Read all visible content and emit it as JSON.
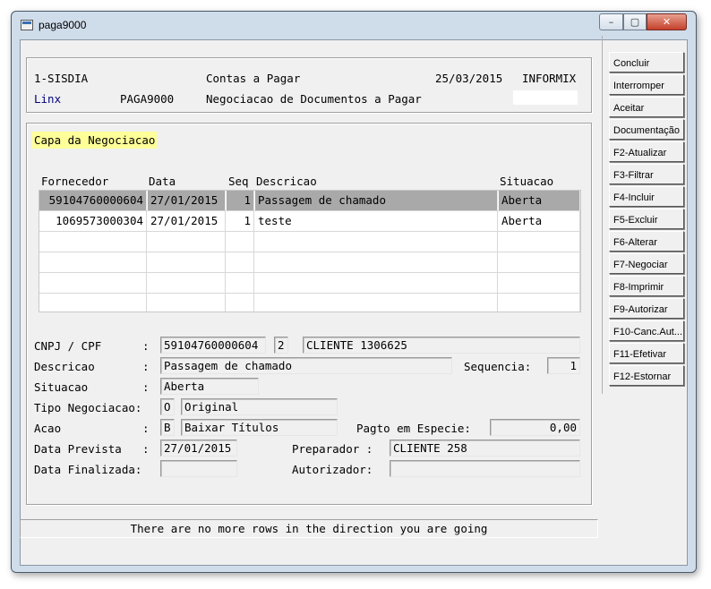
{
  "window": {
    "title": "paga9000",
    "controls": {
      "minimize": "–",
      "maximize": "▢",
      "close": "✕"
    }
  },
  "header": {
    "system": "1-SISDIA",
    "module": "Contas a Pagar",
    "date": "25/03/2015",
    "db": "INFORMIX",
    "company": "Linx",
    "program": "PAGA9000",
    "description": "Negociacao de Documentos a Pagar",
    "extra_value": ""
  },
  "section_title": "Capa da Negociacao",
  "grid": {
    "columns": [
      "Fornecedor",
      "Data",
      "Seq",
      "Descricao",
      "Situacao"
    ],
    "rows": [
      {
        "fornecedor": "59104760000604",
        "data": "27/01/2015",
        "seq": "1",
        "descricao": "Passagem de chamado",
        "situacao": "Aberta",
        "selected": true
      },
      {
        "fornecedor": "1069573000304",
        "data": "27/01/2015",
        "seq": "1",
        "descricao": "teste",
        "situacao": "Aberta",
        "selected": false
      },
      {
        "fornecedor": "",
        "data": "",
        "seq": "",
        "descricao": "",
        "situacao": "",
        "selected": false
      },
      {
        "fornecedor": "",
        "data": "",
        "seq": "",
        "descricao": "",
        "situacao": "",
        "selected": false
      },
      {
        "fornecedor": "",
        "data": "",
        "seq": "",
        "descricao": "",
        "situacao": "",
        "selected": false
      },
      {
        "fornecedor": "",
        "data": "",
        "seq": "",
        "descricao": "",
        "situacao": "",
        "selected": false
      }
    ]
  },
  "form": {
    "cnpj_label": "CNPJ / CPF",
    "cnpj_value": "59104760000604",
    "cnpj_seq": "2",
    "cliente": "CLIENTE 1306625",
    "descricao_label": "Descricao",
    "descricao_value": "Passagem de chamado",
    "sequencia_label": "Sequencia:",
    "sequencia_value": "1",
    "situacao_label": "Situacao",
    "situacao_value": "Aberta",
    "tipo_label": "Tipo Negociacao:",
    "tipo_code": "O",
    "tipo_desc": "Original",
    "acao_label": "Acao",
    "acao_code": "B",
    "acao_desc": "Baixar Títulos",
    "pagto_label": "Pagto em Especie:",
    "pagto_value": "0,00",
    "prevista_label": "Data Prevista",
    "prevista_value": "27/01/2015",
    "preparador_label": "Preparador :",
    "preparador_value": "CLIENTE 258",
    "finalizada_label": "Data Finalizada:",
    "finalizada_value": "",
    "autorizador_label": "Autorizador:",
    "autorizador_value": "",
    "colon": ":"
  },
  "buttons": [
    "Concluir",
    "Interromper",
    "Aceitar",
    "Documentação",
    "F2-Atualizar",
    "F3-Filtrar",
    "F4-Incluir",
    "F5-Excluir",
    "F6-Alterar",
    "F7-Negociar",
    "F8-Imprimir",
    "F9-Autorizar",
    "F10-Canc.Aut...",
    "F11-Efetivar",
    "F12-Estornar"
  ],
  "status_message": "There are no more rows in the direction you are going",
  "colors": {
    "section_highlight": "#ffff99",
    "selected_row": "#a9a9a9",
    "company_text": "#00007a"
  }
}
